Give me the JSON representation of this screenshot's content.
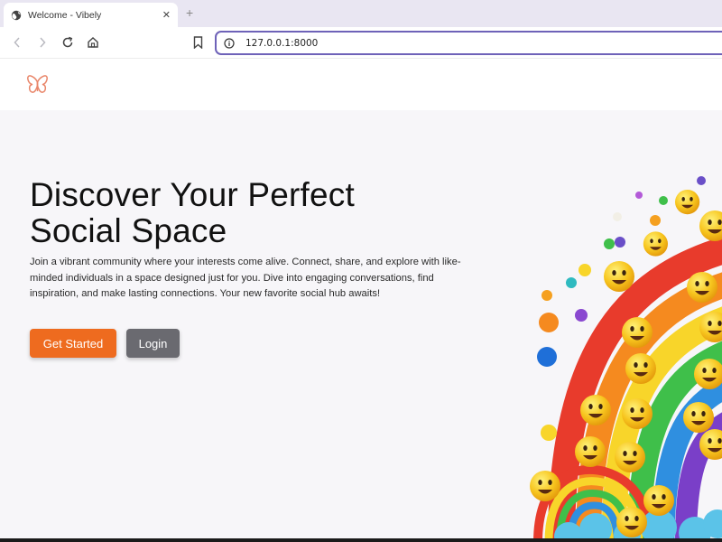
{
  "browser": {
    "tab_title": "Welcome - Vibely",
    "tab_close": "✕",
    "new_tab": "+",
    "url": "127.0.0.1:8000"
  },
  "site": {
    "headline_line1": "Discover Your Perfect",
    "headline_line2": "Social Space",
    "subtext": "Join a vibrant community where your interests come alive. Connect, share, and explore with like-minded individuals in a space designed just for you. Dive into engaging conversations, find inspiration, and make lasting connections. Your new favorite social hub awaits!",
    "buttons": {
      "get_started": "Get Started",
      "login": "Login"
    }
  },
  "colors": {
    "accent_orange": "#ee6b1f",
    "login_gray": "#6a6a70",
    "urlbar_focus": "#6e62b8",
    "logo_stroke": "#e9866a"
  },
  "icons": {
    "tab": "globe-icon",
    "back": "chevron-left-icon",
    "forward": "chevron-right-icon",
    "reload": "reload-icon",
    "home": "home-icon",
    "bookmark": "bookmark-icon",
    "site_info": "info-icon",
    "logo": "butterfly-logo-icon"
  }
}
